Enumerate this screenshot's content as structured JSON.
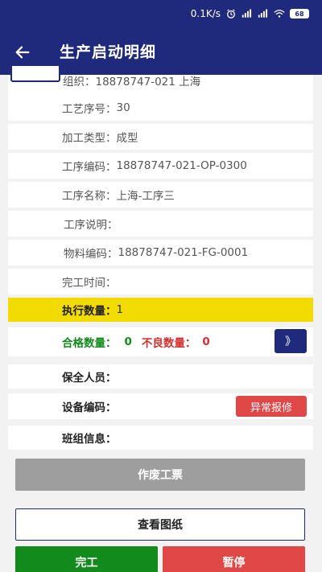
{
  "status_bar": {
    "network_speed": "0.1K/s",
    "battery": "68"
  },
  "header": {
    "title": "生产启动明细"
  },
  "details": {
    "org": {
      "label": "组织：",
      "value": "18878747-021  上海"
    },
    "process_seq": {
      "label": "工艺序号：",
      "value": "30"
    },
    "process_type": {
      "label": "加工类型：",
      "value": "成型"
    },
    "op_code": {
      "label": "工序编码：",
      "value": "18878747-021-OP-0300"
    },
    "op_name": {
      "label": "工序名称：",
      "value": "上海-工序三"
    },
    "op_desc": {
      "label": "工序说明：",
      "value": ""
    },
    "material_code": {
      "label": "物料编码：",
      "value": "18878747-021-FG-0001"
    },
    "finish_time": {
      "label": "完工时间：",
      "value": ""
    },
    "exec_qty": {
      "label": "执行数量：",
      "value": "1"
    },
    "qualified_qty": {
      "label": "合格数量：",
      "value": "0"
    },
    "defect_qty": {
      "label": "不良数量：",
      "value": "0"
    },
    "expand_button": "》",
    "maintainer": {
      "label": "保全人员：",
      "value": ""
    },
    "equipment_code": {
      "label": "设备编码：",
      "value": ""
    },
    "repair_button": "异常报修",
    "team_info": {
      "label": "班组信息：",
      "value": ""
    }
  },
  "actions": {
    "void_ticket": "作废工票",
    "view_drawing": "查看图纸",
    "complete": "完工",
    "pause": "暂停"
  },
  "colors": {
    "primary": "#1f2a7c",
    "highlight": "#f2db00",
    "green": "#138a1c",
    "red": "#e04848",
    "disabled": "#9e9e9e"
  }
}
